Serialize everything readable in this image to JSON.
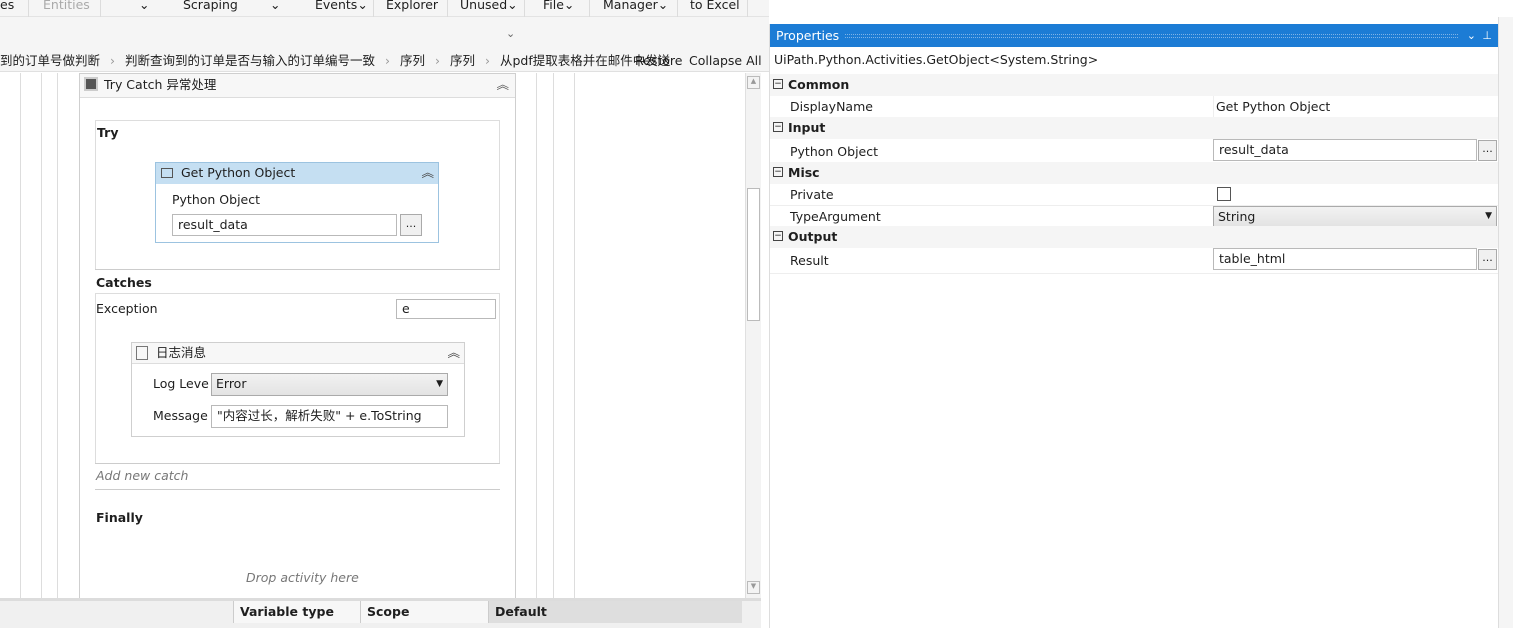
{
  "toolbar": {
    "items": [
      "es",
      "Entities",
      "⌄",
      "Scraping",
      "⌄",
      "Events⌄",
      "Explorer",
      "Unused⌄",
      "File⌄",
      "Manager⌄",
      "to Excel"
    ]
  },
  "breadcrumb": {
    "items": [
      "到的订单号做判断",
      "判断查询到的订单是否与输入的订单编号一致",
      "序列",
      "序列",
      "从pdf提取表格并在邮件中发送"
    ],
    "restore": "Restore",
    "collapse_all": "Collapse All"
  },
  "designer": {
    "try_catch_title": "Try Catch 异常处理",
    "try_label": "Try",
    "get_python": {
      "title": "Get Python Object",
      "field_label": "Python Object",
      "value": "result_data",
      "ellipsis": "..."
    },
    "catches_label": "Catches",
    "exception_label": "Exception",
    "exception_var": "e",
    "log": {
      "title": "日志消息",
      "level_label": "Log Leve",
      "level": "Error",
      "message_label": "Message",
      "message": "\"内容过长，解析失败\" + e.ToString"
    },
    "add_catch": "Add new catch",
    "finally_label": "Finally",
    "drop_hint": "Drop activity here"
  },
  "variables": {
    "headers": [
      "Variable type",
      "Scope",
      "Default"
    ]
  },
  "properties": {
    "title": "Properties",
    "type_name": "UiPath.Python.Activities.GetObject<System.String>",
    "categories": [
      {
        "name": "Common",
        "props": [
          {
            "name": "DisplayName",
            "value": "Get Python Object"
          }
        ]
      },
      {
        "name": "Input",
        "props": [
          {
            "name": "Python Object",
            "value": "result_data"
          }
        ]
      },
      {
        "name": "Misc",
        "props": [
          {
            "name": "Private",
            "checked": false
          },
          {
            "name": "TypeArgument",
            "value": "String"
          }
        ]
      },
      {
        "name": "Output",
        "props": [
          {
            "name": "Result",
            "value": "table_html"
          }
        ]
      }
    ],
    "accent": "#1c7cd5"
  }
}
